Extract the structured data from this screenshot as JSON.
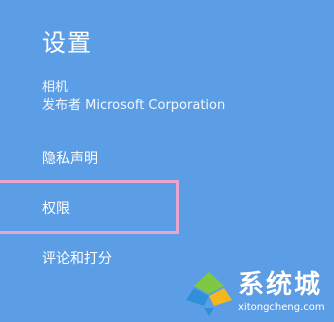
{
  "settings": {
    "title": "设置",
    "app_name": "相机",
    "publisher": "发布者 Microsoft Corporation",
    "items": [
      {
        "label": "隐私声明"
      },
      {
        "label": "权限"
      },
      {
        "label": "评论和打分"
      }
    ]
  },
  "watermark": {
    "brand": "系统城",
    "url": "xitongcheng.com"
  },
  "colors": {
    "background": "#5c9ee6",
    "highlight": "#e8a6cf",
    "text": "#ffffff"
  }
}
